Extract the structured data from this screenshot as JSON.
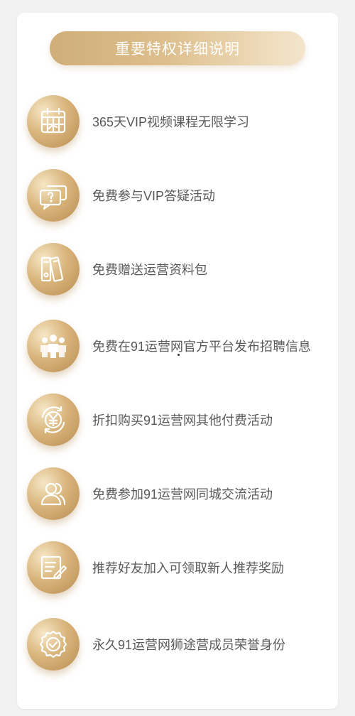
{
  "header": {
    "title": "重要特权详细说明"
  },
  "items": [
    {
      "label": "365天VIP视频课程无限学习",
      "icon": "calendar-icon"
    },
    {
      "label": "免费参与VIP答疑活动",
      "icon": "chat-question-icon"
    },
    {
      "label": "免费赠送运营资料包",
      "icon": "binders-icon"
    },
    {
      "label": "免费在91运营网官方平台发布招聘信息",
      "icon": "people-group-icon"
    },
    {
      "label": "折扣购买91运营网其他付费活动",
      "icon": "yen-cycle-icon"
    },
    {
      "label": "免费参加91运营网同城交流活动",
      "icon": "users-icon"
    },
    {
      "label": "推荐好友加入可领取新人推荐奖励",
      "icon": "edit-document-icon"
    },
    {
      "label": "永久91运营网狮途营成员荣誉身份",
      "icon": "honor-badge-icon"
    }
  ],
  "colors": {
    "gold_dark": "#b98d52",
    "gold_mid": "#d9b57c",
    "gold_light": "#f6e7c6",
    "text": "#5a5a5a"
  }
}
